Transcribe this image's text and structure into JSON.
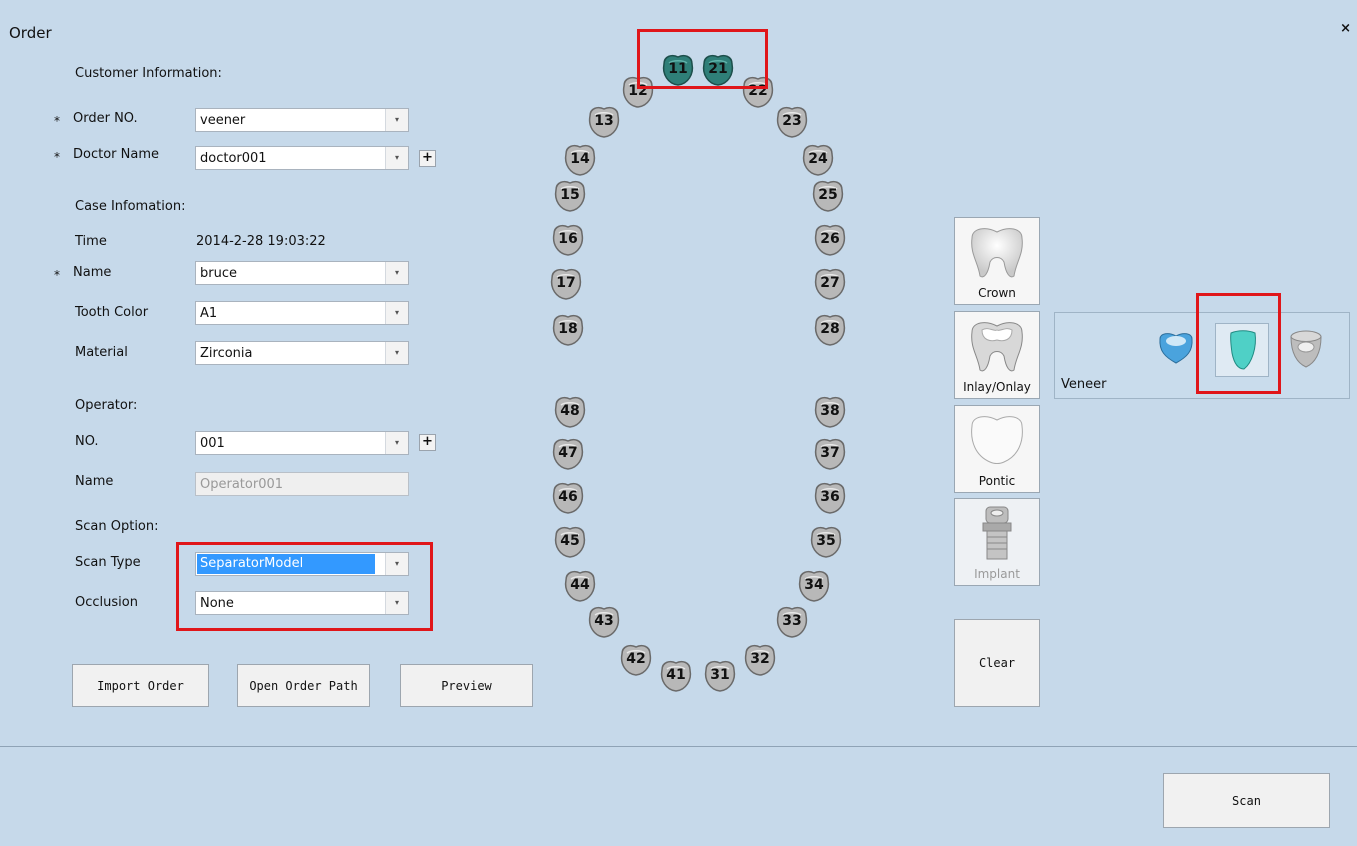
{
  "window": {
    "title": "Order",
    "close": "×"
  },
  "customer": {
    "heading": "Customer Information:",
    "order_no_label": "Order NO.",
    "order_no_value": "veener",
    "doctor_label": "Doctor Name",
    "doctor_value": "doctor001"
  },
  "case": {
    "heading": "Case Infomation:",
    "time_label": "Time",
    "time_value": "2014-2-28 19:03:22",
    "name_label": "Name",
    "name_value": "bruce",
    "tooth_color_label": "Tooth Color",
    "tooth_color_value": "A1",
    "material_label": "Material",
    "material_value": "Zirconia"
  },
  "operator": {
    "heading": "Operator:",
    "no_label": "NO.",
    "no_value": "001",
    "name_label": "Name",
    "name_value": "Operator001"
  },
  "scan_option": {
    "heading": "Scan Option:",
    "scan_type_label": "Scan Type",
    "scan_type_value": "SeparatorModel",
    "occlusion_label": "Occlusion",
    "occlusion_value": "None"
  },
  "required_mark": "*",
  "plus_symbol": "+",
  "dropdown_symbol": "▾",
  "buttons": {
    "import_order": "Import Order",
    "open_order_path": "Open Order Path",
    "preview": "Preview",
    "clear": "Clear",
    "scan": "Scan"
  },
  "restoration_types": {
    "crown": "Crown",
    "inlay_onlay": "Inlay/Onlay",
    "pontic": "Pontic",
    "implant": "Implant",
    "veneer": "Veneer"
  },
  "teeth": {
    "t11": "11",
    "t12": "12",
    "t13": "13",
    "t14": "14",
    "t15": "15",
    "t16": "16",
    "t17": "17",
    "t18": "18",
    "t21": "21",
    "t22": "22",
    "t23": "23",
    "t24": "24",
    "t25": "25",
    "t26": "26",
    "t27": "27",
    "t28": "28",
    "t31": "31",
    "t32": "32",
    "t33": "33",
    "t34": "34",
    "t35": "35",
    "t36": "36",
    "t37": "37",
    "t38": "38",
    "t41": "41",
    "t42": "42",
    "t43": "43",
    "t44": "44",
    "t45": "45",
    "t46": "46",
    "t47": "47",
    "t48": "48"
  },
  "colors": {
    "background": "#c6d9ea",
    "highlight_red": "#e0161a",
    "selected_tooth": "#2f7f78",
    "tooth_gray": "#b8b8b8",
    "selection_blue": "#3399ff"
  }
}
